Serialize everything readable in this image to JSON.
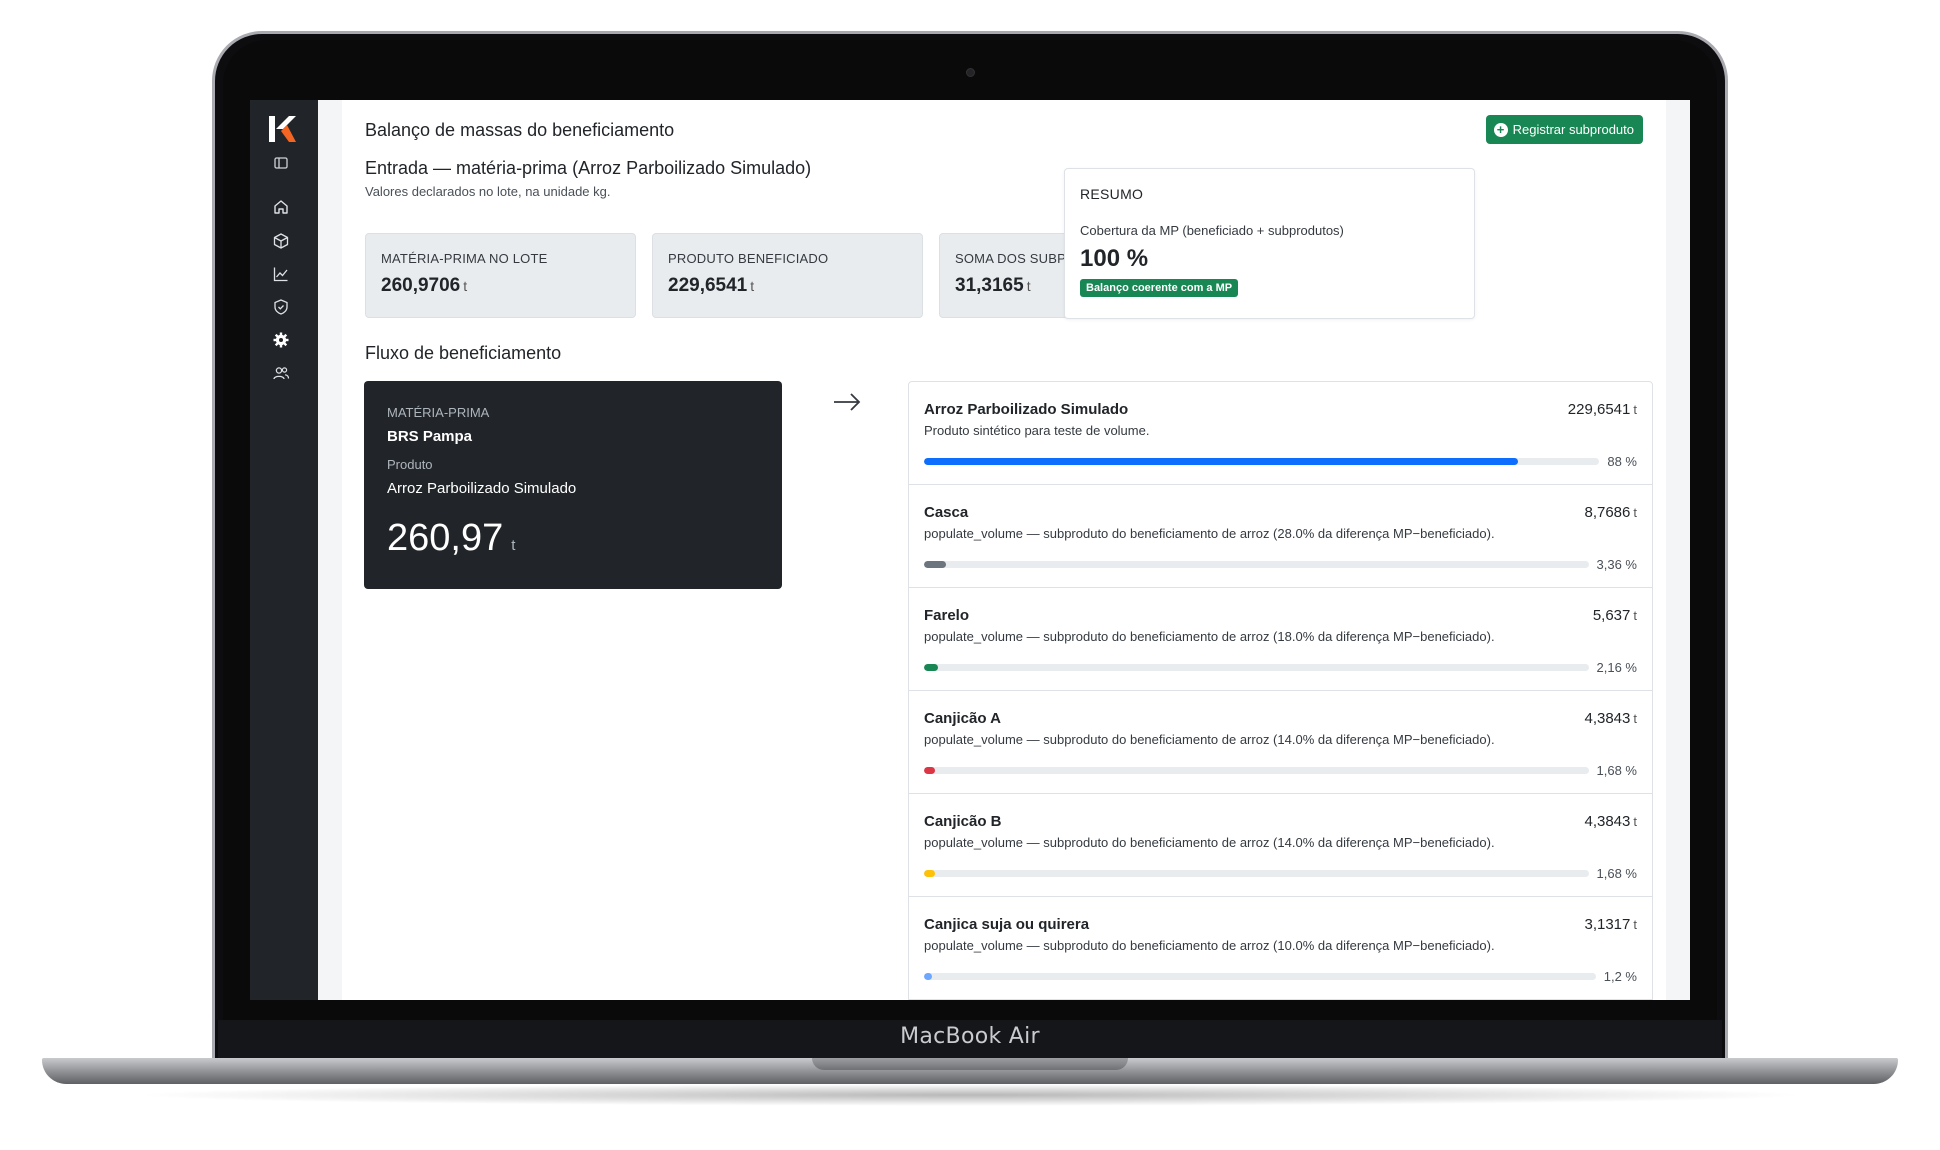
{
  "device": {
    "label": "MacBook Air"
  },
  "header": {
    "title": "Balanço de massas do beneficiamento",
    "register_button": "Registrar subproduto"
  },
  "entrada": {
    "title": "Entrada — matéria-prima (Arroz Parboilizado Simulado)",
    "subtitle": "Valores declarados no lote, na unidade kg."
  },
  "stats": [
    {
      "label": "MATÉRIA-PRIMA NO LOTE",
      "value": "260,9706",
      "unit": "t"
    },
    {
      "label": "PRODUTO BENEFICIADO",
      "value": "229,6541",
      "unit": "t"
    },
    {
      "label": "SOMA DOS SUBPRODUTOS",
      "value": "31,3165",
      "unit": "t"
    }
  ],
  "summary": {
    "title": "RESUMO",
    "label": "Cobertura da MP (beneficiado + subprodutos)",
    "value": "100 %",
    "badge": "Balanço coerente com a MP",
    "coverage_percent": 100
  },
  "fluxo": {
    "title": "Fluxo de beneficiamento",
    "materia_prima": {
      "label": "MATÉRIA-PRIMA",
      "name": "BRS Pampa",
      "product_label": "Produto",
      "product": "Arroz Parboilizado Simulado",
      "value": "260,97",
      "unit": "t"
    },
    "items": [
      {
        "name": "Arroz Parboilizado Simulado",
        "desc": "Produto sintético para teste de volume.",
        "value": "229,6541",
        "unit": "t",
        "pct_label": "88 %",
        "pct": 88,
        "color": "#0d6efd"
      },
      {
        "name": "Casca",
        "desc": "populate_volume — subproduto do beneficiamento de arroz (28.0% da diferença MP−beneficiado).",
        "value": "8,7686",
        "unit": "t",
        "pct_label": "3,36 %",
        "pct": 3.36,
        "color": "#6c757d"
      },
      {
        "name": "Farelo",
        "desc": "populate_volume — subproduto do beneficiamento de arroz (18.0% da diferença MP−beneficiado).",
        "value": "5,637",
        "unit": "t",
        "pct_label": "2,16 %",
        "pct": 2.16,
        "color": "#198754"
      },
      {
        "name": "Canjicão A",
        "desc": "populate_volume — subproduto do beneficiamento de arroz (14.0% da diferença MP−beneficiado).",
        "value": "4,3843",
        "unit": "t",
        "pct_label": "1,68 %",
        "pct": 1.68,
        "color": "#dc3545"
      },
      {
        "name": "Canjicão B",
        "desc": "populate_volume — subproduto do beneficiamento de arroz (14.0% da diferença MP−beneficiado).",
        "value": "4,3843",
        "unit": "t",
        "pct_label": "1,68 %",
        "pct": 1.68,
        "color": "#ffc107"
      },
      {
        "name": "Canjica suja ou quirera",
        "desc": "populate_volume — subproduto do beneficiamento de arroz (10.0% da diferença MP−beneficiado).",
        "value": "3,1317",
        "unit": "t",
        "pct_label": "1,2 %",
        "pct": 1.2,
        "color": "#6ea8fe"
      }
    ]
  },
  "sidebar": {
    "icons": [
      "toggle-sidebar-icon",
      "home-icon",
      "box-icon",
      "chart-line-icon",
      "shield-icon",
      "gear-icon",
      "users-icon"
    ]
  }
}
